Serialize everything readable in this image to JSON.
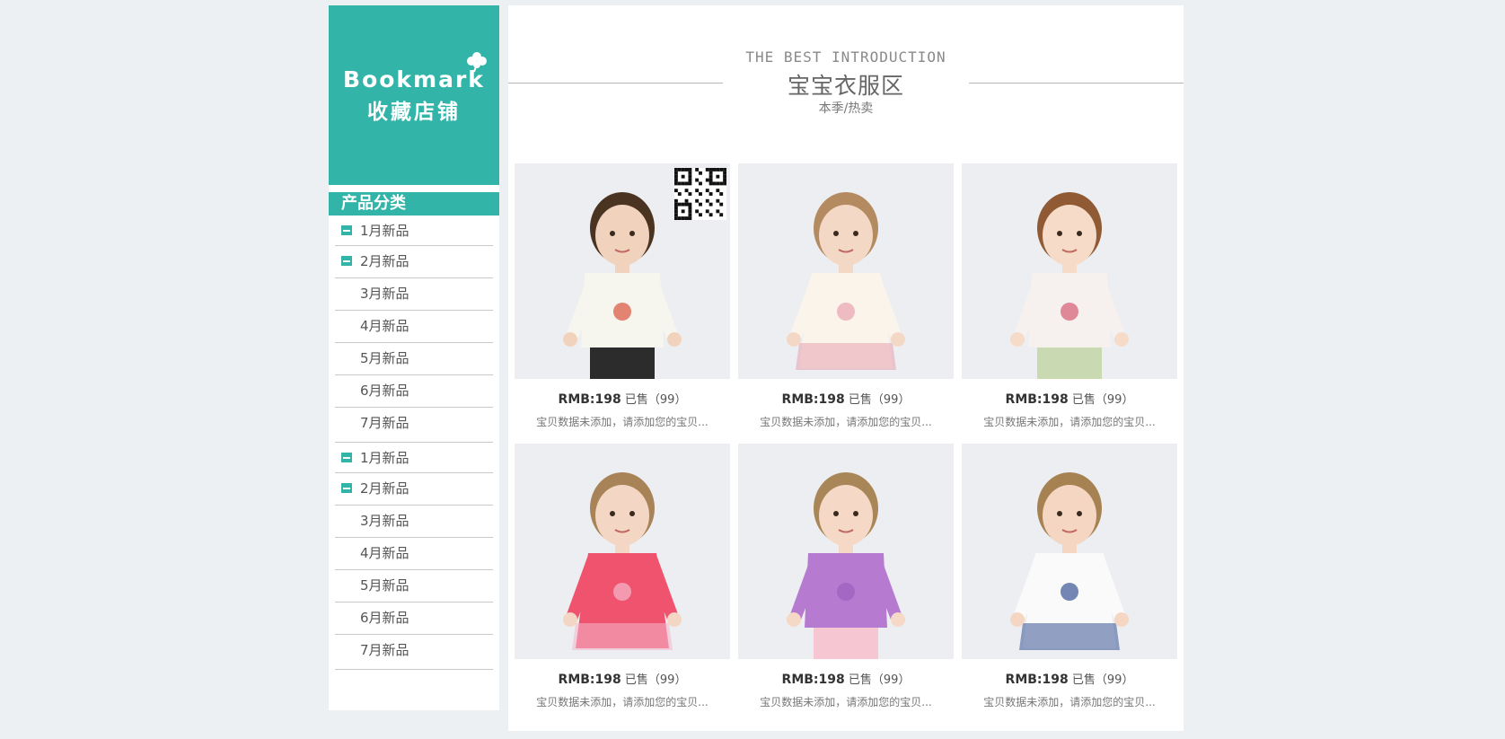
{
  "sidebar": {
    "bookmark_en": "Bookmark",
    "bookmark_zh": "收藏店铺",
    "category_title": "产品分类",
    "categories": [
      {
        "label": "1月新品",
        "expanded": true
      },
      {
        "label": "2月新品",
        "expanded": true
      },
      {
        "label": "3月新品",
        "expanded": false
      },
      {
        "label": "4月新品",
        "expanded": false
      },
      {
        "label": "5月新品",
        "expanded": false
      },
      {
        "label": "6月新品",
        "expanded": false
      },
      {
        "label": "7月新品",
        "expanded": false
      },
      {
        "label": "1月新品",
        "expanded": true
      },
      {
        "label": "2月新品",
        "expanded": true
      },
      {
        "label": "3月新品",
        "expanded": false
      },
      {
        "label": "4月新品",
        "expanded": false
      },
      {
        "label": "5月新品",
        "expanded": false
      },
      {
        "label": "6月新品",
        "expanded": false
      },
      {
        "label": "7月新品",
        "expanded": false
      }
    ]
  },
  "section": {
    "intro_en": "THE BEST INTRODUCTION",
    "title": "宝宝衣服区",
    "subtitle": "本季/热卖"
  },
  "products": [
    {
      "price": "RMB:198",
      "sold": "已售（99）",
      "desc": "宝贝数据未添加，请添加您的宝贝...",
      "outfit": "cream tee, red car print",
      "skin": "#f1d2bc",
      "hair": "#4a3320",
      "top": "#f7f6ee",
      "bottom": "#2c2c2c",
      "accent": "#d9543c"
    },
    {
      "price": "RMB:198",
      "sold": "已售（99）",
      "desc": "宝贝数据未添加，请添加您的宝贝...",
      "outfit": "polka dot dress",
      "skin": "#f4d8c6",
      "hair": "#b48a61",
      "top": "#fbf4ea",
      "bottom": "#fbf4ea",
      "accent": "#e8a3b1"
    },
    {
      "price": "RMB:198",
      "sold": "已售（99）",
      "desc": "宝贝数据未添加，请添加您的宝贝...",
      "outfit": "white long sleeve",
      "skin": "#f5dbc8",
      "hair": "#8f5a34",
      "top": "#f6f1ee",
      "bottom": "#c9d9b2",
      "accent": "#d65b73"
    },
    {
      "price": "RMB:198",
      "sold": "已售（99）",
      "desc": "宝贝数据未添加，请添加您的宝贝...",
      "outfit": "pink polo dress",
      "skin": "#f4d6c4",
      "hair": "#a88358",
      "top": "#f0536e",
      "bottom": "#f0536e",
      "accent": "#f4b8cc"
    },
    {
      "price": "RMB:198",
      "sold": "已售（99）",
      "desc": "宝贝数据未添加，请添加您的宝贝...",
      "outfit": "purple polo",
      "skin": "#f5d8c5",
      "hair": "#a98657",
      "top": "#b67ad1",
      "bottom": "#f6c6d3",
      "accent": "#9d5fbd"
    },
    {
      "price": "RMB:198",
      "sold": "已售（99）",
      "desc": "宝贝数据未添加，请添加您的宝贝...",
      "outfit": "dotted tiered dress",
      "skin": "#f4d6c3",
      "hair": "#a68252",
      "top": "#fafafa",
      "bottom": "#f7f7fb",
      "accent": "#3b5496"
    }
  ],
  "colors": {
    "accent": "#32b5a8",
    "page_bg": "#edf0f3"
  }
}
